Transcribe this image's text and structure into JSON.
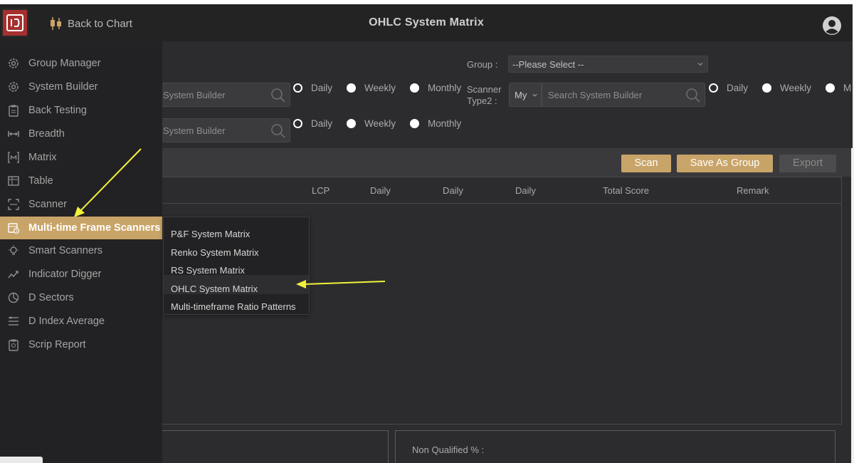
{
  "header": {
    "back_label": "Back to Chart",
    "title": "OHLC System Matrix",
    "accent": "#c9a468"
  },
  "sidebar": {
    "items": [
      {
        "label": "Group Manager",
        "icon": "gear-icon"
      },
      {
        "label": "System Builder",
        "icon": "gear-icon"
      },
      {
        "label": "Back Testing",
        "icon": "clipboard-icon"
      },
      {
        "label": "Breadth",
        "icon": "arrows-horizontal-icon"
      },
      {
        "label": "Matrix",
        "icon": "matrix-icon"
      },
      {
        "label": "Table",
        "icon": "table-icon"
      },
      {
        "label": "Scanner",
        "icon": "scan-icon"
      },
      {
        "label": "Multi-time Frame Scanners",
        "icon": "calendar-clock-icon",
        "active": true
      },
      {
        "label": "Smart Scanners",
        "icon": "bulb-icon"
      },
      {
        "label": "Indicator Digger",
        "icon": "trend-icon"
      },
      {
        "label": "D Sectors",
        "icon": "pie-icon"
      },
      {
        "label": "D Index Average",
        "icon": "list-icon"
      },
      {
        "label": "Scrip Report",
        "icon": "report-icon"
      }
    ]
  },
  "submenu": {
    "items": [
      "P&F System Matrix",
      "Renko System Matrix",
      "RS System Matrix",
      "OHLC System Matrix",
      "Multi-timeframe Ratio Patterns"
    ],
    "highlighted_index": 3
  },
  "filters": {
    "group_label": "Group :",
    "group_select_value": "--Please Select --",
    "scanner_type2_label_line1": "Scanner",
    "scanner_type2_label_line2": "Type2 :",
    "my_select_value": "My",
    "search_placeholder_full": "Search System Builder",
    "search_placeholder_partial": "System Builder",
    "radio_daily": "Daily",
    "radio_weekly": "Weekly",
    "radio_monthly": "Monthly",
    "radio_monthly_cut": "Mon"
  },
  "actions": {
    "scan": "Scan",
    "save_as_group": "Save As Group",
    "export": "Export"
  },
  "table": {
    "columns": [
      "LCP",
      "Daily",
      "Daily",
      "Daily",
      "Total Score",
      "Remark"
    ]
  },
  "summary": {
    "non_qualified_label": "Non Qualified % :"
  }
}
